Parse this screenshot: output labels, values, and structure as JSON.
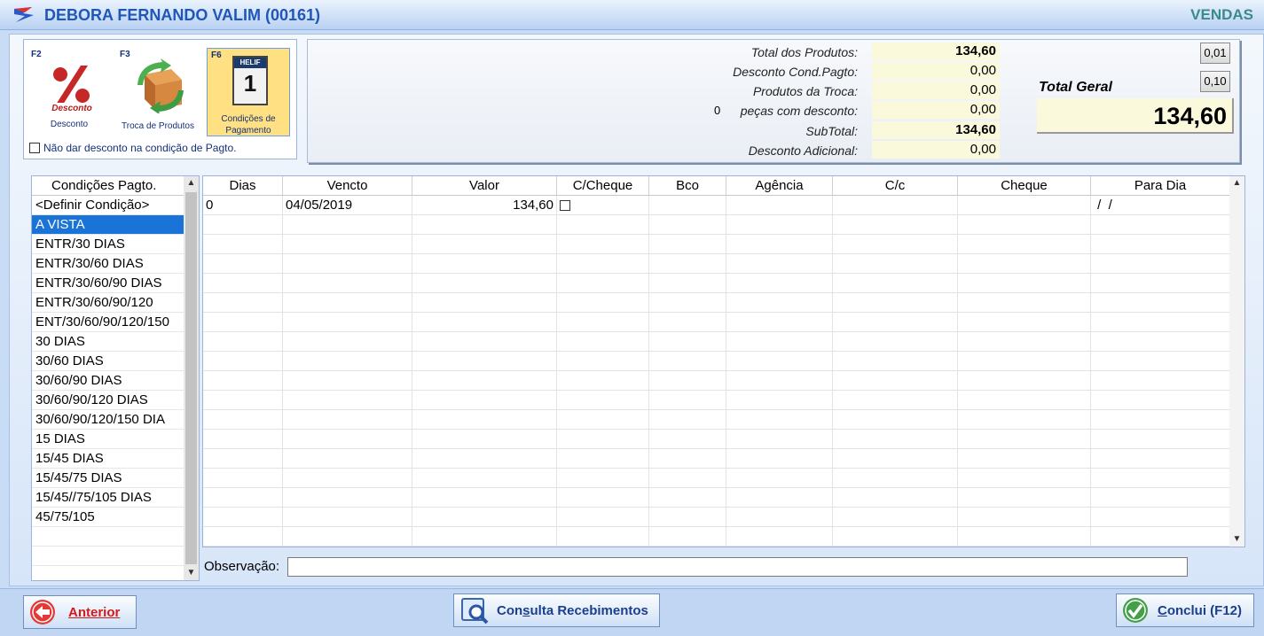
{
  "window": {
    "title": "DEBORA FERNANDO VALIM (00161)",
    "module": "VENDAS"
  },
  "function_keys": [
    {
      "key": "F2",
      "label": "Desconto",
      "icon": "percent-discount-icon"
    },
    {
      "key": "F3",
      "label": "Troca de Produtos",
      "icon": "box-exchange-icon"
    },
    {
      "key": "F6",
      "label_line1": "Condições de",
      "label_line2": "Pagamento",
      "icon": "calendar-icon",
      "calendar_brand": "HELIF",
      "calendar_day": "1"
    }
  ],
  "no_discount_checkbox": {
    "label": "Não dar desconto na condição de Pagto.",
    "checked": false
  },
  "totals": {
    "total_produtos": {
      "label": "Total dos Produtos:",
      "value": "134,60"
    },
    "desconto_cond": {
      "label": "Desconto Cond.Pagto:",
      "value": "0,00"
    },
    "produtos_troca": {
      "label": "Produtos da Troca:",
      "value": "0,00"
    },
    "pecas_desconto": {
      "count": "0",
      "label": "peças com desconto:",
      "value": "0,00"
    },
    "subtotal": {
      "label": "SubTotal:",
      "value": "134,60"
    },
    "desconto_adicional": {
      "label": "Desconto Adicional:",
      "value": "0,00"
    },
    "total_geral": {
      "label": "Total Geral",
      "value": "134,60"
    },
    "round_buttons": [
      "0,01",
      "0,10"
    ]
  },
  "conditions": {
    "header": "Condições Pagto.",
    "selected": "A VISTA",
    "items": [
      "<Definir Condição>",
      "A VISTA",
      "ENTR/30 DIAS",
      "ENTR/30/60 DIAS",
      "ENTR/30/60/90 DIAS",
      "ENTR/30/60/90/120",
      "ENT/30/60/90/120/150",
      "30 DIAS",
      "30/60 DIAS",
      "30/60/90 DIAS",
      "30/60/90/120 DIAS",
      "30/60/90/120/150 DIA",
      "15 DIAS",
      "15/45 DIAS",
      "15/45/75 DIAS",
      "15/45//75/105 DIAS",
      "45/75/105"
    ]
  },
  "grid": {
    "columns": [
      "Dias",
      "Vencto",
      "Valor",
      "C/Cheque",
      "Bco",
      "Agência",
      "C/c",
      "Cheque",
      "Para Dia"
    ],
    "rows": [
      {
        "dias": "0",
        "vencto": "04/05/2019",
        "valor": "134,60",
        "c_cheque": false,
        "bco": "",
        "agencia": "",
        "cc": "",
        "cheque": "",
        "para_dia": " /  /"
      }
    ]
  },
  "observacao": {
    "label": "Observação:",
    "value": ""
  },
  "buttons": {
    "anterior": "Anterior",
    "consulta_prefix": "Con",
    "consulta_underlined": "s",
    "consulta_rest": "ulta Recebimentos",
    "conclui_underlined": "C",
    "conclui_rest": "onclui (F12)"
  },
  "colors": {
    "title": "#1f56b8",
    "module": "#3b8a8a",
    "selection": "#1a73d6",
    "anterior": "#d21a1a"
  }
}
